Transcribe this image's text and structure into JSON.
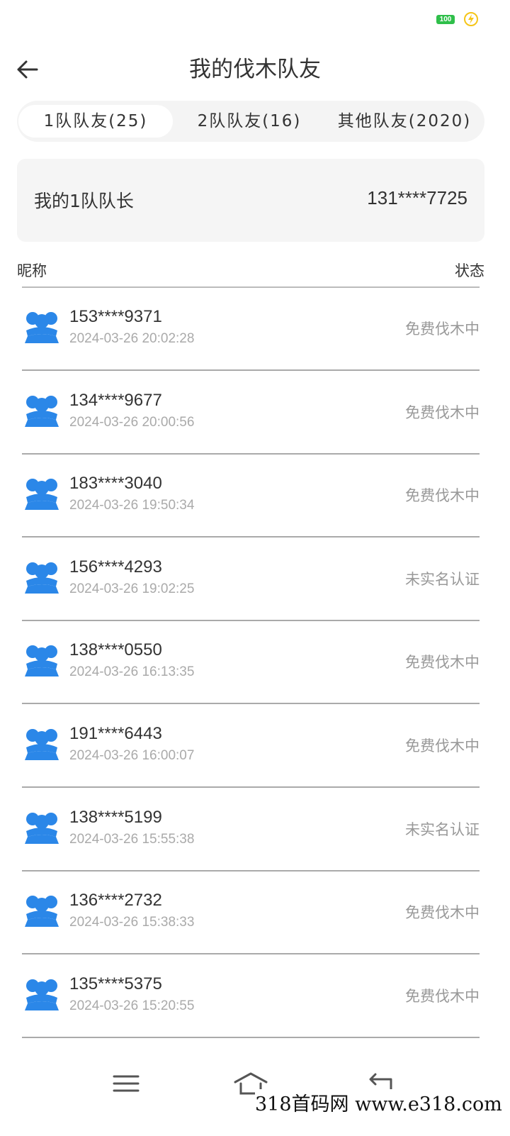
{
  "status_bar": {
    "battery_level": "100",
    "charging_icon": "lightning-icon"
  },
  "header": {
    "back_icon": "arrow-left-icon",
    "title": "我的伐木队友"
  },
  "tabs": [
    {
      "label": "1队队友(25)",
      "active": true
    },
    {
      "label": "2队队友(16)",
      "active": false
    },
    {
      "label": "其他队友(2020)",
      "active": false
    }
  ],
  "captain": {
    "label": "我的1队队长",
    "value": "131****7725"
  },
  "list_header": {
    "nickname": "昵称",
    "status": "状态"
  },
  "members": [
    {
      "phone": "153****9371",
      "time": "2024-03-26 20:02:28",
      "status": "免费伐木中"
    },
    {
      "phone": "134****9677",
      "time": "2024-03-26 20:00:56",
      "status": "免费伐木中"
    },
    {
      "phone": "183****3040",
      "time": "2024-03-26 19:50:34",
      "status": "免费伐木中"
    },
    {
      "phone": "156****4293",
      "time": "2024-03-26 19:02:25",
      "status": "未实名认证"
    },
    {
      "phone": "138****0550",
      "time": "2024-03-26 16:13:35",
      "status": "免费伐木中"
    },
    {
      "phone": "191****6443",
      "time": "2024-03-26 16:00:07",
      "status": "免费伐木中"
    },
    {
      "phone": "138****5199",
      "time": "2024-03-26 15:55:38",
      "status": "未实名认证"
    },
    {
      "phone": "136****2732",
      "time": "2024-03-26 15:38:33",
      "status": "免费伐木中"
    },
    {
      "phone": "135****5375",
      "time": "2024-03-26 15:20:55",
      "status": "免费伐木中"
    }
  ],
  "nav_bar": {
    "menu_icon": "menu-icon",
    "home_icon": "home-icon",
    "back_icon": "return-icon"
  },
  "watermark": "318首码网  www.e318.com",
  "colors": {
    "accent": "#2b87e8",
    "battery": "#2fbf4a",
    "charge": "#f5c518"
  }
}
